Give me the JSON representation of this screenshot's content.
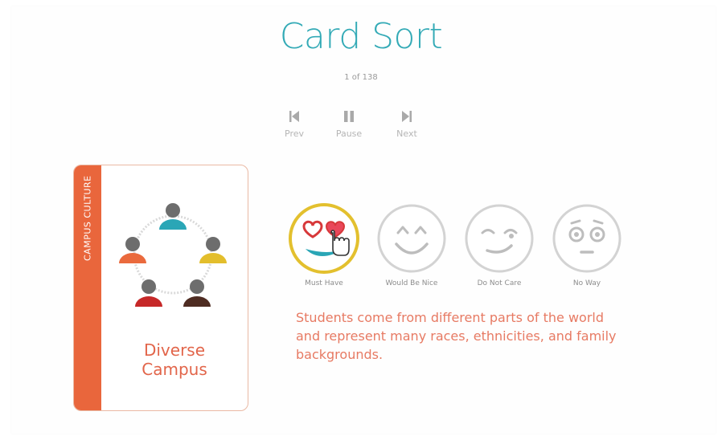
{
  "page": {
    "title": "Card Sort",
    "counter": "1 of 138"
  },
  "controls": [
    {
      "label": "Prev",
      "icon": "skip-back-icon"
    },
    {
      "label": "Pause",
      "icon": "pause-icon"
    },
    {
      "label": "Next",
      "icon": "skip-forward-icon"
    }
  ],
  "card": {
    "category": "CAMPUS CULTURE",
    "title_line1": "Diverse",
    "title_line2": "Campus",
    "icon": "diverse-people-circle-icon"
  },
  "ratings": [
    {
      "label": "Must Have",
      "icon": "hearts-in-hand-icon",
      "selected": true
    },
    {
      "label": "Would Be Nice",
      "icon": "happy-face-icon",
      "selected": false
    },
    {
      "label": "Do Not Care",
      "icon": "smirk-face-icon",
      "selected": false
    },
    {
      "label": "No Way",
      "icon": "shocked-face-icon",
      "selected": false
    }
  ],
  "description": "Students come from different parts of the world and represent many races, ethnicities, and family backgrounds.",
  "colors": {
    "title": "#33aab6",
    "card_strip": "#e9663c",
    "card_text": "#e2654a",
    "description": "#e77a63",
    "selected_ring": "#e3c02e"
  }
}
